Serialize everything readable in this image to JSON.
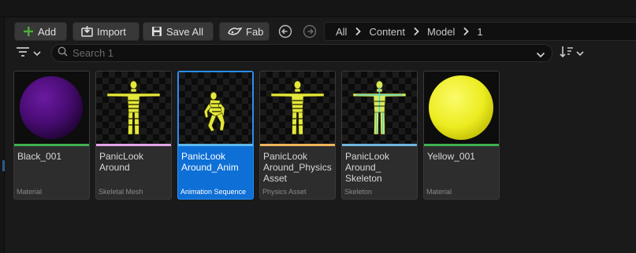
{
  "toolbar": {
    "add_label": "Add",
    "import_label": "Import",
    "save_all_label": "Save All",
    "fab_label": "Fab"
  },
  "breadcrumb": [
    "All",
    "Content",
    "Model",
    "1"
  ],
  "search": {
    "placeholder": "Search 1",
    "value": ""
  },
  "colors": {
    "accent_add": "#4caf3a",
    "selection": "#0e6fd6",
    "material_bar": "#3fb04f",
    "skeletal_mesh_bar": "#e2a4e8",
    "animation_bar": "#5fb8e8",
    "physics_bar": "#f0b45a",
    "skeleton_bar": "#6fb6e0"
  },
  "assets": [
    {
      "name": "Black_001",
      "type": "Material",
      "bar_color": "#3fb04f",
      "thumb": "purple-sphere",
      "selected": false
    },
    {
      "name": "PanicLook Around",
      "type": "Skeletal Mesh",
      "bar_color": "#e2a4e8",
      "thumb": "yellow-figure",
      "selected": false
    },
    {
      "name": "PanicLook Around_Anim",
      "type": "Animation Sequence",
      "bar_color": "#5fb8e8",
      "thumb": "crouching-figure",
      "selected": true
    },
    {
      "name": "PanicLook Around_Physics Asset",
      "type": "Physics Asset",
      "bar_color": "#f0b45a",
      "thumb": "yellow-figure",
      "selected": false
    },
    {
      "name": "PanicLook Around_ Skeleton",
      "type": "Skeleton",
      "bar_color": "#6fb6e0",
      "thumb": "skeleton-figure",
      "selected": false
    },
    {
      "name": "Yellow_001",
      "type": "Material",
      "bar_color": "#3fb04f",
      "thumb": "yellow-sphere",
      "selected": false
    }
  ]
}
